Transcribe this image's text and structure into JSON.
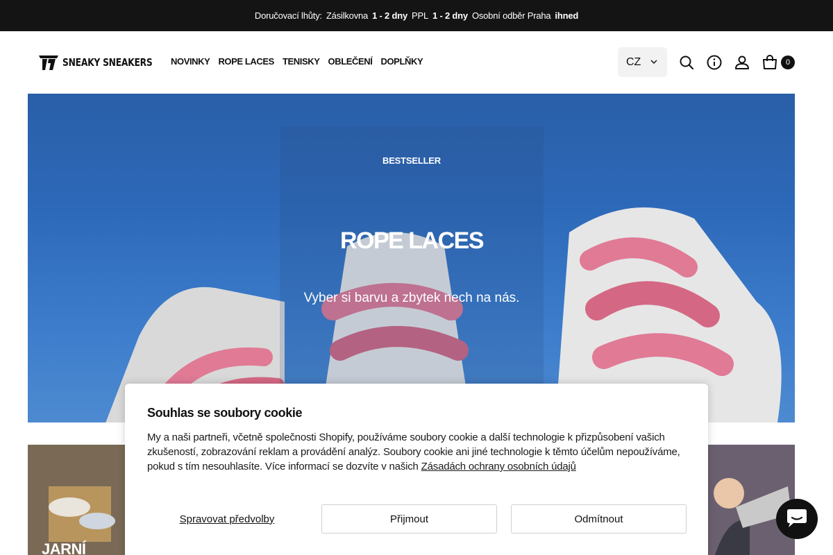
{
  "announcement": {
    "prefix": "Doručovací lhůty:",
    "carrier1": "Zásilkovna",
    "time1": "1 - 2 dny",
    "carrier2": "PPL",
    "time2": "1 - 2 dny",
    "pickup": "Osobní odběr Praha",
    "pickup_time": "ihned"
  },
  "header": {
    "logo_text": "SNEAKY SNEAKERS",
    "nav": [
      "NOVINKY",
      "ROPE LACES",
      "TENISKY",
      "OBLEČENÍ",
      "DOPLŇKY"
    ],
    "language": "CZ",
    "cart_count": "0",
    "icons": [
      "search-icon",
      "info-icon",
      "account-icon",
      "cart-icon"
    ]
  },
  "hero": {
    "eyebrow": "BESTSELLER",
    "title": "ROPE LACES",
    "subtitle": "Vyber si barvu a zbytek nech na nás."
  },
  "tiles": {
    "left_label": "JARNÍ"
  },
  "cookie": {
    "title": "Souhlas se soubory cookie",
    "text": "My a naši partneři, včetně společnosti Shopify, používáme soubory cookie a další technologie k přizpůsobení vašich zkušeností, zobrazování reklam a provádění analýz. Soubory cookie ani jiné technologie k těmto účelům nepoužíváme, pokud s tím nesouhlasíte. Více informací se dozvíte v našich ",
    "link": "Zásadách ochrany osobních údajů",
    "manage": "Spravovat předvolby",
    "accept": "Přijmout",
    "decline": "Odmítnout"
  },
  "colors": {
    "topbar": "#141414",
    "accent": "#111111",
    "sky": "#2d69b9",
    "lace_pink": "#e07a95"
  }
}
